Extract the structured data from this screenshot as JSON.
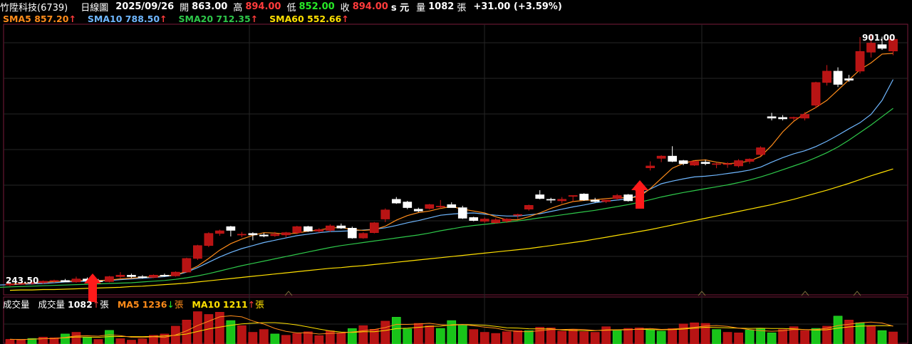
{
  "header": {
    "stock_name": "竹陞科技(6739)",
    "period": "日線圖",
    "date": "2025/09/26",
    "open_label": "開",
    "open": "863.00",
    "high_label": "高",
    "high": "894.00",
    "low_label": "低",
    "low": "852.00",
    "close_label": "收",
    "close": "894.00",
    "suffix": "s 元",
    "vol_label": "量",
    "vol": "1082",
    "vol_unit": "張",
    "change": "+31.00 (+3.59%)"
  },
  "ma_legend": [
    {
      "label": "SMA5",
      "value": "857.20",
      "arrow": "↑",
      "color": "#ff8c1a"
    },
    {
      "label": "SMA10",
      "value": "788.50",
      "arrow": "↑",
      "color": "#6fb7ff"
    },
    {
      "label": "SMA20",
      "value": "712.35",
      "arrow": "↑",
      "color": "#2ec84a"
    },
    {
      "label": "SMA60",
      "value": "552.66",
      "arrow": "↑",
      "color": "#ffe000"
    }
  ],
  "volume_legend": {
    "title": "成交量",
    "vol_label": "成交量",
    "vol_value": "1082",
    "vol_arrow": "↑",
    "vol_unit": "張",
    "ma5_label": "MA5",
    "ma5_value": "1236",
    "ma5_arrow": "↓",
    "ma5_unit": "張",
    "ma10_label": "MA10",
    "ma10_value": "1211",
    "ma10_arrow": "↑",
    "ma10_unit": "張"
  },
  "chart_data": {
    "type": "candlestick",
    "price_ylim": [
      220,
      930
    ],
    "low_label": "243.50",
    "high_label": "901.00",
    "colors": {
      "up": "#b81414",
      "down": "#ffffff",
      "grid": "#262626",
      "border": "#7a1a3a",
      "sma5": "#ff8c1a",
      "sma10": "#6fb7ff",
      "sma20": "#2ec84a",
      "sma60": "#ffe000"
    },
    "candles": [
      {
        "o": 246,
        "h": 250,
        "l": 243.5,
        "c": 249
      },
      {
        "o": 249,
        "h": 252,
        "l": 246,
        "c": 250
      },
      {
        "o": 250,
        "h": 255,
        "l": 247,
        "c": 252
      },
      {
        "o": 252,
        "h": 258,
        "l": 249,
        "c": 256
      },
      {
        "o": 256,
        "h": 260,
        "l": 252,
        "c": 258
      },
      {
        "o": 258,
        "h": 262,
        "l": 254,
        "c": 254
      },
      {
        "o": 254,
        "h": 268,
        "l": 252,
        "c": 262
      },
      {
        "o": 262,
        "h": 266,
        "l": 255,
        "c": 257
      },
      {
        "o": 257,
        "h": 262,
        "l": 250,
        "c": 255
      },
      {
        "o": 255,
        "h": 270,
        "l": 253,
        "c": 268
      },
      {
        "o": 268,
        "h": 280,
        "l": 264,
        "c": 272
      },
      {
        "o": 272,
        "h": 276,
        "l": 265,
        "c": 268
      },
      {
        "o": 268,
        "h": 272,
        "l": 263,
        "c": 266
      },
      {
        "o": 266,
        "h": 274,
        "l": 264,
        "c": 272
      },
      {
        "o": 272,
        "h": 276,
        "l": 268,
        "c": 270
      },
      {
        "o": 270,
        "h": 282,
        "l": 268,
        "c": 280
      },
      {
        "o": 280,
        "h": 318,
        "l": 278,
        "c": 316
      },
      {
        "o": 316,
        "h": 352,
        "l": 312,
        "c": 350
      },
      {
        "o": 350,
        "h": 385,
        "l": 346,
        "c": 382
      },
      {
        "o": 382,
        "h": 392,
        "l": 376,
        "c": 389
      },
      {
        "o": 400,
        "h": 402,
        "l": 374,
        "c": 390
      },
      {
        "o": 378,
        "h": 386,
        "l": 372,
        "c": 380
      },
      {
        "o": 382,
        "h": 385,
        "l": 364,
        "c": 378
      },
      {
        "o": 378,
        "h": 383,
        "l": 372,
        "c": 375
      },
      {
        "o": 376,
        "h": 386,
        "l": 373,
        "c": 380
      },
      {
        "o": 378,
        "h": 386,
        "l": 372,
        "c": 384
      },
      {
        "o": 384,
        "h": 402,
        "l": 380,
        "c": 400
      },
      {
        "o": 400,
        "h": 402,
        "l": 386,
        "c": 388
      },
      {
        "o": 388,
        "h": 396,
        "l": 384,
        "c": 392
      },
      {
        "o": 390,
        "h": 406,
        "l": 386,
        "c": 402
      },
      {
        "o": 402,
        "h": 408,
        "l": 394,
        "c": 396
      },
      {
        "o": 396,
        "h": 400,
        "l": 368,
        "c": 370
      },
      {
        "o": 370,
        "h": 385,
        "l": 368,
        "c": 382
      },
      {
        "o": 384,
        "h": 412,
        "l": 382,
        "c": 410
      },
      {
        "o": 420,
        "h": 448,
        "l": 412,
        "c": 444
      },
      {
        "o": 472,
        "h": 478,
        "l": 460,
        "c": 462
      },
      {
        "o": 465,
        "h": 468,
        "l": 446,
        "c": 450
      },
      {
        "o": 446,
        "h": 450,
        "l": 438,
        "c": 441
      },
      {
        "o": 448,
        "h": 460,
        "l": 445,
        "c": 458
      },
      {
        "o": 452,
        "h": 470,
        "l": 448,
        "c": 454
      },
      {
        "o": 458,
        "h": 464,
        "l": 452,
        "c": 450
      },
      {
        "o": 450,
        "h": 455,
        "l": 420,
        "c": 422
      },
      {
        "o": 424,
        "h": 426,
        "l": 414,
        "c": 416
      },
      {
        "o": 414,
        "h": 424,
        "l": 410,
        "c": 420
      },
      {
        "o": 410,
        "h": 422,
        "l": 408,
        "c": 418
      },
      {
        "o": 414,
        "h": 422,
        "l": 410,
        "c": 420
      },
      {
        "o": 432,
        "h": 434,
        "l": 420,
        "c": 432
      },
      {
        "o": 446,
        "h": 458,
        "l": 442,
        "c": 456
      },
      {
        "o": 484,
        "h": 496,
        "l": 472,
        "c": 474
      },
      {
        "o": 472,
        "h": 476,
        "l": 462,
        "c": 470
      },
      {
        "o": 468,
        "h": 478,
        "l": 461,
        "c": 472
      },
      {
        "o": 480,
        "h": 482,
        "l": 466,
        "c": 482
      },
      {
        "o": 486,
        "h": 488,
        "l": 468,
        "c": 470
      },
      {
        "o": 470,
        "h": 476,
        "l": 464,
        "c": 466
      },
      {
        "o": 466,
        "h": 470,
        "l": 462,
        "c": 470
      },
      {
        "o": 474,
        "h": 486,
        "l": 470,
        "c": 482
      },
      {
        "o": 484,
        "h": 486,
        "l": 466,
        "c": 468
      },
      {
        "o": 498,
        "h": 500,
        "l": 496,
        "c": 498
      },
      {
        "o": 555,
        "h": 572,
        "l": 548,
        "c": 560
      },
      {
        "o": 580,
        "h": 588,
        "l": 570,
        "c": 586
      },
      {
        "o": 586,
        "h": 612,
        "l": 570,
        "c": 572
      },
      {
        "o": 574,
        "h": 576,
        "l": 562,
        "c": 566
      },
      {
        "o": 562,
        "h": 574,
        "l": 560,
        "c": 572
      },
      {
        "o": 570,
        "h": 576,
        "l": 562,
        "c": 566
      },
      {
        "o": 564,
        "h": 568,
        "l": 554,
        "c": 566
      },
      {
        "o": 566,
        "h": 570,
        "l": 555,
        "c": 566
      },
      {
        "o": 560,
        "h": 578,
        "l": 556,
        "c": 574
      },
      {
        "o": 572,
        "h": 580,
        "l": 566,
        "c": 578
      },
      {
        "o": 590,
        "h": 612,
        "l": 586,
        "c": 608
      },
      {
        "o": 690,
        "h": 700,
        "l": 680,
        "c": 686
      },
      {
        "o": 688,
        "h": 694,
        "l": 680,
        "c": 684
      },
      {
        "o": 688,
        "h": 690,
        "l": 680,
        "c": 688
      },
      {
        "o": 686,
        "h": 702,
        "l": 680,
        "c": 696
      },
      {
        "o": 720,
        "h": 782,
        "l": 712,
        "c": 780
      },
      {
        "o": 780,
        "h": 826,
        "l": 772,
        "c": 810
      },
      {
        "o": 810,
        "h": 820,
        "l": 768,
        "c": 775
      },
      {
        "o": 790,
        "h": 800,
        "l": 782,
        "c": 786
      },
      {
        "o": 810,
        "h": 900,
        "l": 804,
        "c": 862
      },
      {
        "o": 860,
        "h": 905,
        "l": 846,
        "c": 884
      },
      {
        "o": 880,
        "h": 901,
        "l": 866,
        "c": 870
      },
      {
        "o": 863,
        "h": 894,
        "l": 852,
        "c": 894
      }
    ],
    "sma5": [
      248,
      250,
      251,
      253,
      255,
      256,
      258,
      258,
      258,
      259,
      262,
      264,
      266,
      268,
      270,
      273,
      282,
      296,
      316,
      338,
      355,
      367,
      377,
      384,
      383,
      380,
      383,
      388,
      391,
      396,
      398,
      392,
      390,
      392,
      401,
      417,
      429,
      437,
      441,
      448,
      453,
      446,
      441,
      436,
      426,
      418,
      418,
      426,
      436,
      448,
      458,
      466,
      469,
      471,
      474,
      476,
      476,
      478,
      500,
      527,
      554,
      567,
      574,
      576,
      570,
      566,
      568,
      573,
      585,
      614,
      650,
      678,
      698,
      714,
      733,
      760,
      787,
      814,
      832,
      855,
      857
    ],
    "sma10": [
      246,
      247,
      248,
      249,
      250,
      252,
      254,
      255,
      256,
      257,
      258,
      260,
      262,
      264,
      266,
      268,
      272,
      280,
      292,
      306,
      320,
      332,
      342,
      350,
      358,
      364,
      370,
      376,
      380,
      384,
      387,
      388,
      389,
      391,
      393,
      397,
      403,
      410,
      416,
      423,
      430,
      433,
      435,
      436,
      433,
      430,
      428,
      428,
      431,
      434,
      440,
      446,
      452,
      457,
      463,
      467,
      470,
      473,
      484,
      499,
      513,
      520,
      526,
      531,
      533,
      536,
      540,
      544,
      549,
      557,
      570,
      582,
      592,
      600,
      611,
      625,
      641,
      658,
      674,
      696,
      733,
      788
    ],
    "sma20": [
      240,
      241,
      242,
      243,
      244,
      245,
      246,
      247,
      248,
      249,
      250,
      251,
      252,
      254,
      256,
      258,
      261,
      265,
      270,
      276,
      283,
      290,
      297,
      303,
      309,
      315,
      321,
      327,
      333,
      339,
      345,
      350,
      354,
      358,
      362,
      366,
      370,
      374,
      378,
      383,
      389,
      394,
      399,
      403,
      406,
      409,
      412,
      415,
      419,
      423,
      427,
      431,
      435,
      439,
      443,
      448,
      453,
      458,
      464,
      471,
      478,
      484,
      490,
      495,
      500,
      505,
      510,
      516,
      523,
      531,
      540,
      550,
      560,
      570,
      582,
      595,
      610,
      628,
      648,
      668,
      690,
      712
    ],
    "sma60": [
      232,
      233,
      233,
      234,
      234,
      235,
      236,
      237,
      238,
      239,
      240,
      242,
      243,
      245,
      247,
      249,
      251,
      254,
      257,
      260,
      263,
      266,
      269,
      272,
      275,
      278,
      281,
      284,
      287,
      290,
      292,
      295,
      297,
      300,
      303,
      306,
      309,
      312,
      315,
      318,
      321,
      324,
      327,
      330,
      333,
      336,
      339,
      342,
      346,
      350,
      354,
      358,
      362,
      367,
      372,
      377,
      382,
      387,
      392,
      398,
      404,
      410,
      416,
      422,
      428,
      434,
      440,
      446,
      452,
      458,
      465,
      472,
      480,
      488,
      496,
      505,
      514,
      524,
      534,
      543,
      552
    ],
    "volumes": [
      {
        "v": 420,
        "up": true
      },
      {
        "v": 380,
        "up": true
      },
      {
        "v": 500,
        "up": false
      },
      {
        "v": 620,
        "up": true
      },
      {
        "v": 560,
        "up": true
      },
      {
        "v": 900,
        "up": false
      },
      {
        "v": 1050,
        "up": true
      },
      {
        "v": 580,
        "up": false
      },
      {
        "v": 410,
        "up": true
      },
      {
        "v": 1220,
        "up": false
      },
      {
        "v": 480,
        "up": true
      },
      {
        "v": 350,
        "up": true
      },
      {
        "v": 460,
        "up": true
      },
      {
        "v": 780,
        "up": true
      },
      {
        "v": 900,
        "up": true
      },
      {
        "v": 1600,
        "up": true
      },
      {
        "v": 2150,
        "up": true
      },
      {
        "v": 2900,
        "up": true
      },
      {
        "v": 2650,
        "up": true
      },
      {
        "v": 2850,
        "up": true
      },
      {
        "v": 2100,
        "up": false
      },
      {
        "v": 1650,
        "up": true
      },
      {
        "v": 1050,
        "up": true
      },
      {
        "v": 1300,
        "up": true
      },
      {
        "v": 900,
        "up": false
      },
      {
        "v": 780,
        "up": true
      },
      {
        "v": 950,
        "up": true
      },
      {
        "v": 1100,
        "up": true
      },
      {
        "v": 750,
        "up": true
      },
      {
        "v": 1180,
        "up": true
      },
      {
        "v": 980,
        "up": true
      },
      {
        "v": 1380,
        "up": false
      },
      {
        "v": 1650,
        "up": true
      },
      {
        "v": 1320,
        "up": true
      },
      {
        "v": 2050,
        "up": true
      },
      {
        "v": 2400,
        "up": false
      },
      {
        "v": 1350,
        "up": false
      },
      {
        "v": 1850,
        "up": true
      },
      {
        "v": 1650,
        "up": true
      },
      {
        "v": 1400,
        "up": false
      },
      {
        "v": 2100,
        "up": false
      },
      {
        "v": 1720,
        "up": false
      },
      {
        "v": 1300,
        "up": true
      },
      {
        "v": 1050,
        "up": true
      },
      {
        "v": 950,
        "up": true
      },
      {
        "v": 1100,
        "up": true
      },
      {
        "v": 1200,
        "up": true
      },
      {
        "v": 1200,
        "up": false
      },
      {
        "v": 1500,
        "up": true
      },
      {
        "v": 1450,
        "up": true
      },
      {
        "v": 1150,
        "up": true
      },
      {
        "v": 1300,
        "up": true
      },
      {
        "v": 1100,
        "up": true
      },
      {
        "v": 1050,
        "up": true
      },
      {
        "v": 1550,
        "up": true
      },
      {
        "v": 1250,
        "up": false
      },
      {
        "v": 1400,
        "up": true
      },
      {
        "v": 1450,
        "up": true
      },
      {
        "v": 1280,
        "up": false
      },
      {
        "v": 1150,
        "up": false
      },
      {
        "v": 1380,
        "up": true
      },
      {
        "v": 1800,
        "up": true
      },
      {
        "v": 1900,
        "up": true
      },
      {
        "v": 1850,
        "up": true
      },
      {
        "v": 1300,
        "up": false
      },
      {
        "v": 1050,
        "up": true
      },
      {
        "v": 1000,
        "up": true
      },
      {
        "v": 1250,
        "up": false
      },
      {
        "v": 1400,
        "up": false
      },
      {
        "v": 1000,
        "up": false
      },
      {
        "v": 1300,
        "up": true
      },
      {
        "v": 1550,
        "up": true
      },
      {
        "v": 1200,
        "up": true
      },
      {
        "v": 1400,
        "up": false
      },
      {
        "v": 1600,
        "up": true
      },
      {
        "v": 2500,
        "up": false
      },
      {
        "v": 2150,
        "up": true
      },
      {
        "v": 1900,
        "up": false
      },
      {
        "v": 1650,
        "up": true
      },
      {
        "v": 1200,
        "up": false
      },
      {
        "v": 1082,
        "up": true
      }
    ]
  }
}
